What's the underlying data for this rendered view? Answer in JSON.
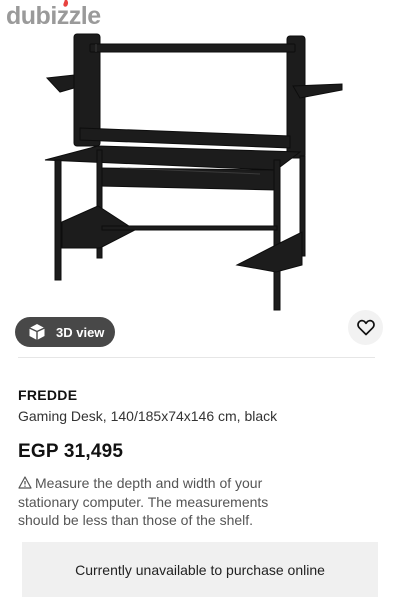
{
  "watermark": {
    "brand": "dubizzle"
  },
  "image": {
    "subject": "black gaming desk",
    "color": "#1c1c1c"
  },
  "actions": {
    "view3d_label": "3D view",
    "view3d_icon": "cube-icon",
    "favorite_icon": "heart-icon"
  },
  "product": {
    "name": "FREDDE",
    "description": "Gaming Desk, 140/185x74x146 cm, black",
    "price": "EGP 31,495"
  },
  "notice": {
    "icon": "warning-icon",
    "text": "Measure the depth and width of your stationary computer. The measurements should be less than those of the shelf."
  },
  "availability": {
    "text": "Currently unavailable to purchase online"
  },
  "colors": {
    "button_dark": "#484848",
    "panel_bg": "#f0f0f0",
    "watermark_gray": "#9a9a9a"
  }
}
